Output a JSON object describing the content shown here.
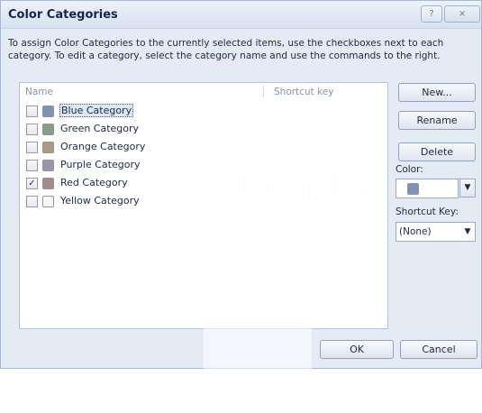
{
  "window": {
    "title": "Color Categories",
    "help_glyph": "?",
    "close_glyph": "×"
  },
  "instructions": "To assign Color Categories to the currently selected items, use the checkboxes next to each category.  To edit a category, select the category name and use the commands to the right.",
  "list": {
    "header_name": "Name",
    "header_shortcut": "Shortcut key",
    "items": [
      {
        "label": "Blue Category",
        "checked": false,
        "color": "#7f94b3",
        "selected": true,
        "check_glyph": ""
      },
      {
        "label": "Green Category",
        "checked": false,
        "color": "#8a9d88",
        "selected": false,
        "check_glyph": ""
      },
      {
        "label": "Orange Category",
        "checked": false,
        "color": "#a99b87",
        "selected": false,
        "check_glyph": ""
      },
      {
        "label": "Purple Category",
        "checked": false,
        "color": "#9e94a9",
        "selected": false,
        "check_glyph": ""
      },
      {
        "label": "Red Category",
        "checked": true,
        "color": "#a48b8b",
        "selected": false,
        "check_glyph": "✓"
      },
      {
        "label": "Yellow Category",
        "checked": false,
        "color": "#f5f6f8",
        "selected": false,
        "check_glyph": ""
      }
    ]
  },
  "buttons": {
    "new_label": "New...",
    "rename_label": "Rename",
    "delete_label": "Delete",
    "ok_label": "OK",
    "cancel_label": "Cancel"
  },
  "color_picker": {
    "label": "Color:",
    "swatch_color": "#7f94b3",
    "arrow_glyph": "▼"
  },
  "shortcut_key": {
    "label": "Shortcut Key:",
    "value": "(None)",
    "arrow_glyph": "▼"
  },
  "watermark_text": "DropBo"
}
